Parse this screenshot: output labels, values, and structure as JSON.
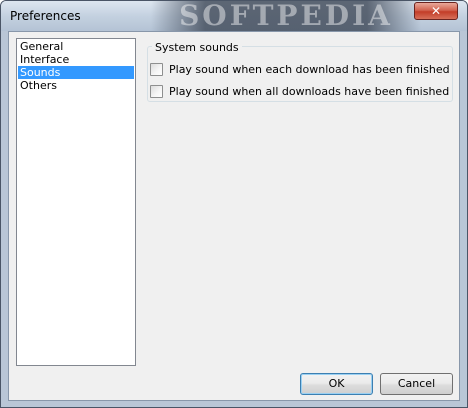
{
  "window": {
    "title": "Preferences",
    "watermark": "SOFTPEDIA",
    "close_glyph": "✕"
  },
  "sidebar": {
    "items": [
      {
        "label": "General",
        "selected": false
      },
      {
        "label": "Interface",
        "selected": false
      },
      {
        "label": "Sounds",
        "selected": true
      },
      {
        "label": "Others",
        "selected": false
      }
    ]
  },
  "sounds": {
    "group_title": "System sounds",
    "options": [
      {
        "label": "Play sound when each download has been finished",
        "checked": false
      },
      {
        "label": "Play sound when all downloads have been finished",
        "checked": false
      }
    ]
  },
  "buttons": {
    "ok": "OK",
    "cancel": "Cancel"
  },
  "colors": {
    "selection": "#3399ff",
    "dialog_bg": "#f0f0f0",
    "close_button": "#c33d28"
  }
}
